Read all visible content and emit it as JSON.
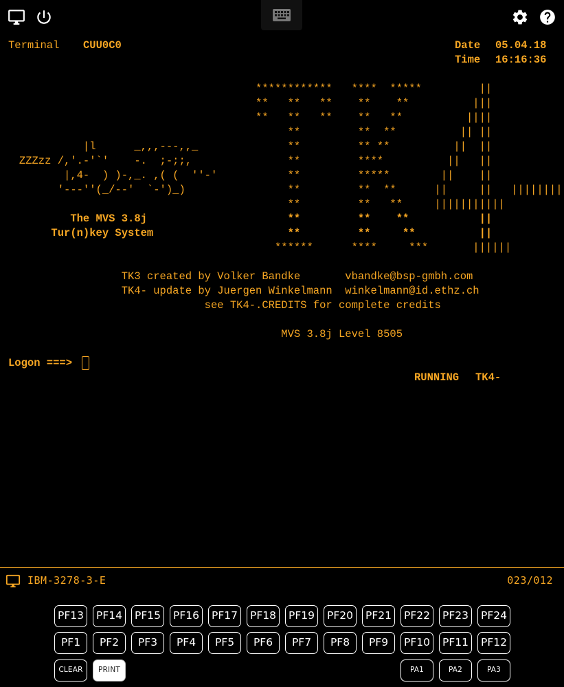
{
  "toolbar": {
    "left_icons": [
      "monitor-icon",
      "power-icon"
    ],
    "center_icon": "keyboard-icon",
    "right_icons": [
      "gear-icon",
      "help-icon"
    ]
  },
  "colors": {
    "amber": "#f6a623",
    "background": "#000000",
    "key_border": "#ffffff"
  },
  "screen": {
    "terminal_label": "Terminal",
    "terminal_id": "CUU0C0",
    "date_label": "Date",
    "date_value": "05.04.18",
    "time_label": "Time",
    "time_value": "16:16:36",
    "banner_lines": [
      "                                        ************   ****  *****         ||",
      "                                        **   **   **    **    **          |||",
      "                                        **   **   **    **   **          ||||",
      "                                             **         **  **          || ||",
      "             |l      _,,,---,,_              **         ** **          ||  ||",
      "   ZZZzz /,'.-'`'    -.  ;-;;,               **         ****          ||   ||",
      "          |,4-  ) )-,_. ,( (  ''-'           **         *****        ||    ||",
      "         '---''(_/--'  `-')_)                **         **  **      ||     ||   ||||||||||",
      "                                             **         **   **     |||||||||||",
      "           The MVS 3.8j                      **         **    **           ||",
      "        Tur(n)key System                     **         **     **          ||",
      "                                           ******      ****     ***       ||||||"
    ],
    "credit_lines": [
      "                   TK3 created by Volker Bandke       vbandke@bsp-gmbh.com",
      "                   TK4- update by Juergen Winkelmann  winkelmann@id.ethz.ch",
      "                                see TK4-.CREDITS for complete credits",
      "                                            MVS 3.8j Level 8505"
    ],
    "logon_prompt": "Logon ===>",
    "logon_value": "",
    "running_label": "RUNNING",
    "running_system": "TK4-"
  },
  "status": {
    "icon": "monitor-icon",
    "model": "IBM-3278-3-E",
    "cursor_position": "023/012"
  },
  "keys": {
    "row1": [
      "PF13",
      "PF14",
      "PF15",
      "PF16",
      "PF17",
      "PF18",
      "PF19",
      "PF20",
      "PF21",
      "PF22",
      "PF23",
      "PF24"
    ],
    "row2": [
      "PF1",
      "PF2",
      "PF3",
      "PF4",
      "PF5",
      "PF6",
      "PF7",
      "PF8",
      "PF9",
      "PF10",
      "PF11",
      "PF12"
    ],
    "clear": "CLEAR",
    "print": "PRINT",
    "pa": [
      "PA1",
      "PA2",
      "PA3"
    ]
  }
}
